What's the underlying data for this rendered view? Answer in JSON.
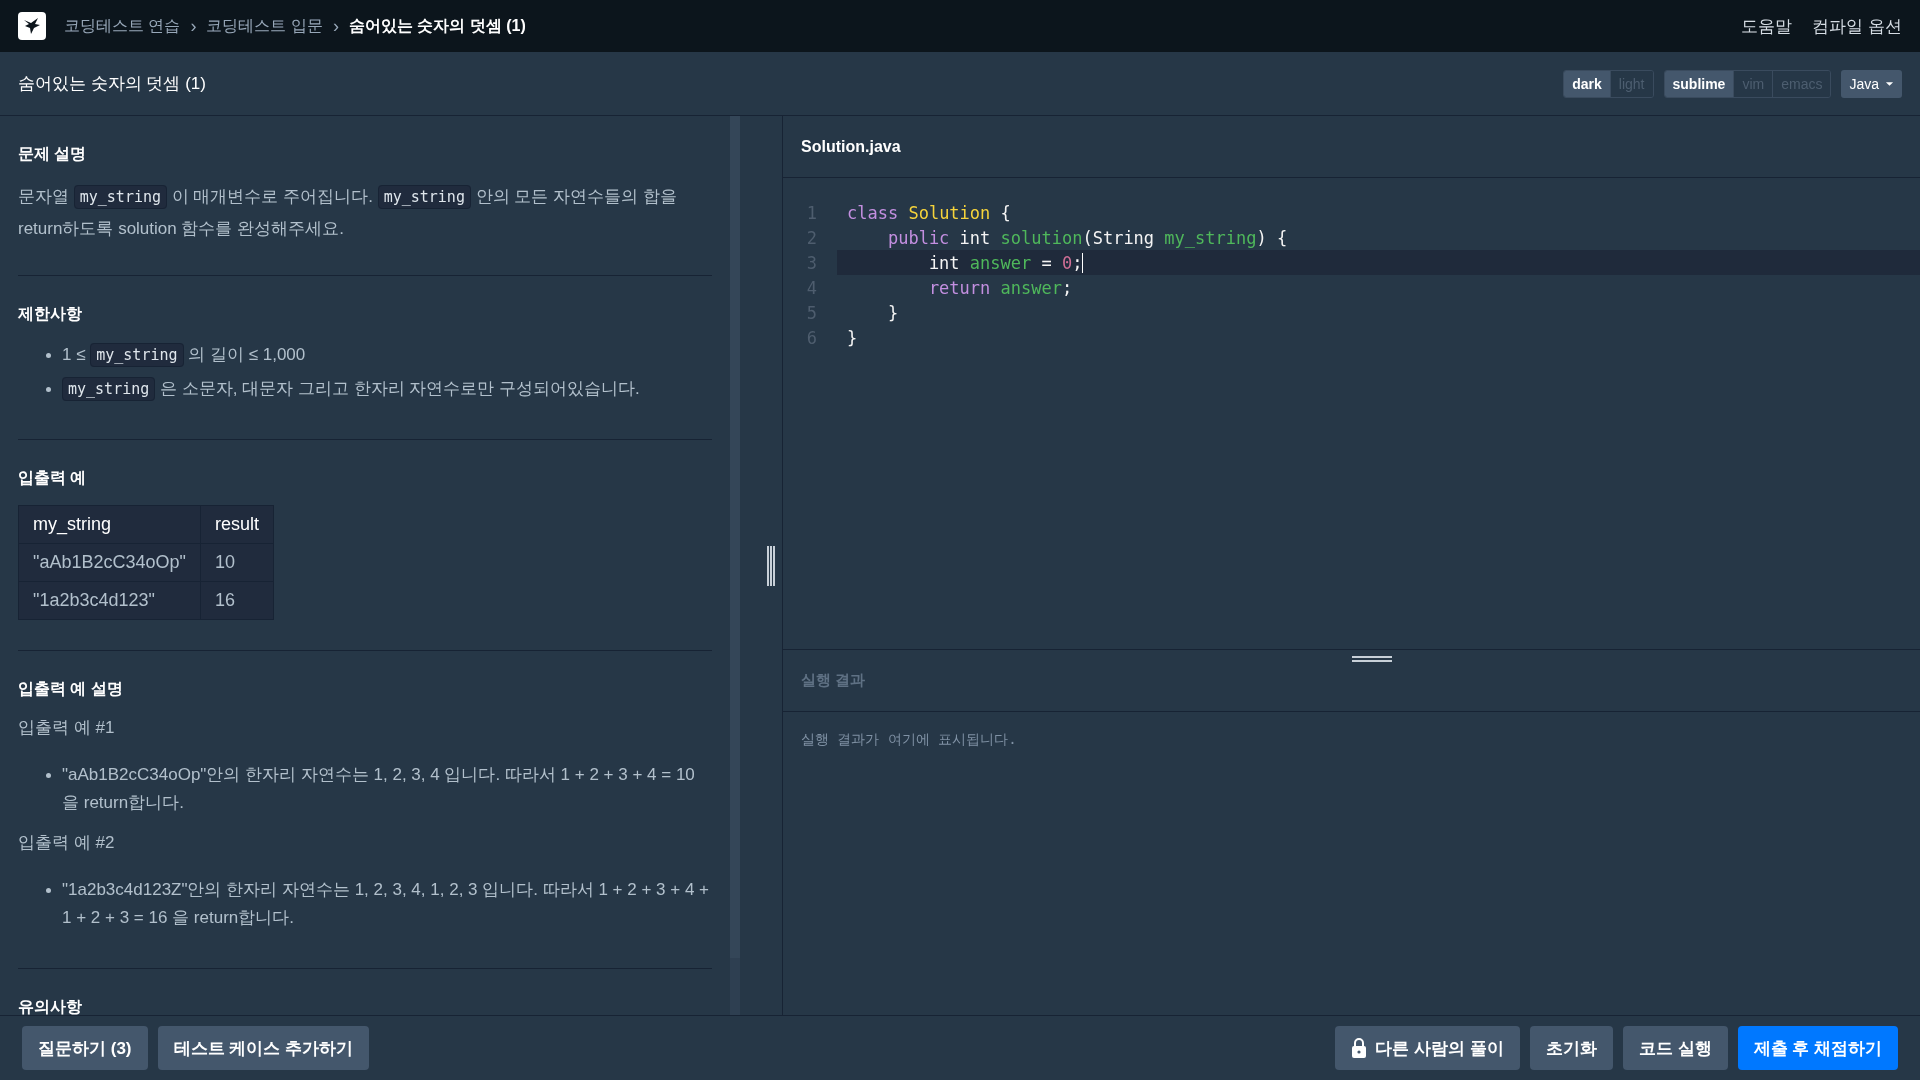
{
  "nav": {
    "breadcrumbs": [
      {
        "label": "코딩테스트 연습",
        "current": false
      },
      {
        "label": "코딩테스트 입문",
        "current": false
      },
      {
        "label": "숨어있는 숫자의 덧셈 (1)",
        "current": true
      }
    ],
    "separator": "›",
    "links": [
      "도움말",
      "컴파일 옵션"
    ]
  },
  "header": {
    "title": "숨어있는 숫자의 덧셈 (1)",
    "toggles": [
      [
        {
          "label": "dark",
          "selected": true
        },
        {
          "label": "light",
          "selected": false
        }
      ],
      [
        {
          "label": "sublime",
          "selected": true
        },
        {
          "label": "vim",
          "selected": false
        },
        {
          "label": "emacs",
          "selected": false
        }
      ]
    ],
    "language": "Java"
  },
  "sections": [
    {
      "title": "문제 설명",
      "blocks": [
        {
          "kind": "paragraph",
          "segments": [
            {
              "kind": "text",
              "text": "문자열 "
            },
            {
              "kind": "code",
              "text": "my_string"
            },
            {
              "kind": "text",
              "text": " 이 매개변수로 주어집니다. "
            },
            {
              "kind": "code",
              "text": "my_string"
            },
            {
              "kind": "text",
              "text": " 안의 모든 자연수들의 합을 return하도록 solution 함수를 완성해주세요."
            }
          ]
        }
      ]
    },
    {
      "title": "제한사항",
      "blocks": [
        {
          "kind": "bullets",
          "items": [
            [
              {
                "kind": "text",
                "text": "1 ≤ "
              },
              {
                "kind": "code",
                "text": "my_string"
              },
              {
                "kind": "text",
                "text": " 의 길이 ≤ 1,000"
              }
            ],
            [
              {
                "kind": "code",
                "text": "my_string"
              },
              {
                "kind": "text",
                "text": " 은 소문자, 대문자 그리고 한자리 자연수로만 구성되어있습니다."
              }
            ]
          ]
        }
      ]
    },
    {
      "title": "입출력 예",
      "blocks": [
        {
          "kind": "table",
          "columns": [
            "my_string",
            "result"
          ],
          "rows": [
            [
              "\"aAb1B2cC34oOp\"",
              "10"
            ],
            [
              "\"1a2b3c4d123\"",
              "16"
            ]
          ]
        }
      ]
    },
    {
      "title": "입출력 예 설명",
      "blocks": [
        {
          "kind": "subheading",
          "text": "입출력 예 #1"
        },
        {
          "kind": "bullets",
          "items": [
            [
              {
                "kind": "text",
                "text": "\"aAb1B2cC34oOp\"안의 한자리 자연수는 1, 2, 3, 4 입니다. 따라서 1 + 2 + 3 + 4 = 10 을 return합니다."
              }
            ]
          ]
        },
        {
          "kind": "subheading",
          "text": "입출력 예 #2"
        },
        {
          "kind": "bullets",
          "items": [
            [
              {
                "kind": "text",
                "text": "\"1a2b3c4d123Z\"안의 한자리 자연수는 1, 2, 3, 4, 1, 2, 3 입니다. 따라서 1 + 2 + 3 + 4 + 1 + 2 + 3 = 16 을 return합니다."
              }
            ]
          ]
        }
      ]
    },
    {
      "title": "유의사항"
    }
  ],
  "editor": {
    "filename": "Solution.java",
    "lines": [
      {
        "number": "1",
        "active": false,
        "tokens": [
          {
            "kind": "keyword",
            "text": "class"
          },
          {
            "kind": "type",
            "text": " Solution"
          },
          {
            "kind": "plain",
            "text": " {"
          }
        ]
      },
      {
        "number": "2",
        "active": false,
        "tokens": [
          {
            "kind": "keyword",
            "text": "    public"
          },
          {
            "kind": "plain",
            "text": " int "
          },
          {
            "kind": "func",
            "text": "solution"
          },
          {
            "kind": "plain",
            "text": "(String "
          },
          {
            "kind": "func",
            "text": "my_string"
          },
          {
            "kind": "plain",
            "text": ") {"
          }
        ]
      },
      {
        "number": "3",
        "active": true,
        "tokens": [
          {
            "kind": "plain",
            "text": "        int "
          },
          {
            "kind": "func",
            "text": "answer"
          },
          {
            "kind": "plain",
            "text": " = "
          },
          {
            "kind": "number",
            "text": "0"
          },
          {
            "kind": "plain",
            "text": ";"
          }
        ]
      },
      {
        "number": "4",
        "active": false,
        "tokens": [
          {
            "kind": "keyword",
            "text": "        return"
          },
          {
            "kind": "func",
            "text": " answer"
          },
          {
            "kind": "plain",
            "text": ";"
          }
        ]
      },
      {
        "number": "5",
        "active": false,
        "tokens": [
          {
            "kind": "plain",
            "text": "    }"
          }
        ]
      },
      {
        "number": "6",
        "active": false,
        "tokens": [
          {
            "kind": "plain",
            "text": "}"
          }
        ]
      }
    ]
  },
  "result": {
    "title": "실행 결과",
    "message": "실행 결과가 여기에 표시됩니다."
  },
  "footer": {
    "left": [
      {
        "label": "질문하기 (3)",
        "kind": "secondary",
        "locked": false
      },
      {
        "label": "테스트 케이스 추가하기",
        "kind": "secondary",
        "locked": false
      }
    ],
    "right": [
      {
        "label": "다른 사람의 풀이",
        "kind": "secondary",
        "locked": true
      },
      {
        "label": "초기화",
        "kind": "secondary",
        "locked": false
      },
      {
        "label": "코드 실행",
        "kind": "secondary",
        "locked": false
      },
      {
        "label": "제출 후 채점하기",
        "kind": "primary",
        "locked": false
      }
    ]
  }
}
